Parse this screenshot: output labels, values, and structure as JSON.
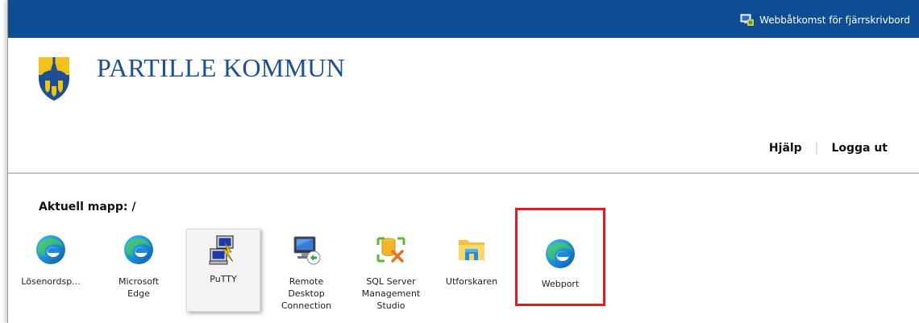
{
  "topbar": {
    "link_label": "Webbåtkomst för fjärrskrivbord"
  },
  "brand": {
    "name": "PARTILLE KOMMUN",
    "color": "#1c4f93"
  },
  "header": {
    "help_label": "Hjälp",
    "separator": "|",
    "logout_label": "Logga ut"
  },
  "folder": {
    "label": "Aktuell mapp: /"
  },
  "apps": [
    {
      "label": "Lösenordsp...",
      "icon": "edge-icon"
    },
    {
      "label": "Microsoft Edge",
      "icon": "edge-icon"
    },
    {
      "label": "PuTTY",
      "icon": "putty-icon",
      "state": "selected"
    },
    {
      "label": "Remote Desktop Connection",
      "icon": "remote-desktop-icon"
    },
    {
      "label": "SQL Server Management Studio",
      "icon": "sql-server-icon"
    },
    {
      "label": "Utforskaren",
      "icon": "file-explorer-icon"
    },
    {
      "label": "Webport",
      "icon": "edge-icon",
      "state": "highlighted"
    }
  ],
  "colors": {
    "topbar": "#0d4d93",
    "highlight_border": "#e01b22"
  }
}
